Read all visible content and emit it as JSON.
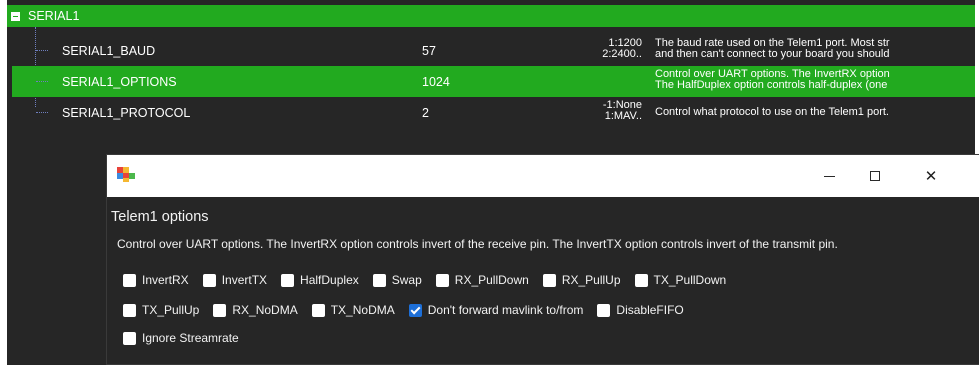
{
  "tree": {
    "group": {
      "label": "SERIAL1"
    },
    "params": [
      {
        "name": "SERIAL1_BAUD",
        "value": "57",
        "options": [
          "1:1200",
          "2:2400.."
        ],
        "desc": [
          "The baud rate used on the Telem1 port. Most str",
          "and then can't connect to your board you should"
        ],
        "selected": false
      },
      {
        "name": "SERIAL1_OPTIONS",
        "value": "1024",
        "options": [],
        "desc": [
          "Control over UART options. The InvertRX option",
          "The HalfDuplex option controls half-duplex (one"
        ],
        "selected": true
      },
      {
        "name": "SERIAL1_PROTOCOL",
        "value": "2",
        "options": [
          "-1:None",
          "1:MAV.."
        ],
        "desc": [
          "Control what protocol to use on the Telem1 port."
        ],
        "selected": false
      }
    ]
  },
  "dialog": {
    "title": "Telem1 options",
    "description": "Control over UART options. The InvertRX option controls invert of the receive pin. The InvertTX option controls invert of the transmit pin.",
    "window_controls": {
      "minimize": "—",
      "close": "✕"
    },
    "option_rows": [
      [
        {
          "label": "InvertRX",
          "checked": false
        },
        {
          "label": "InvertTX",
          "checked": false
        },
        {
          "label": "HalfDuplex",
          "checked": false
        },
        {
          "label": "Swap",
          "checked": false
        },
        {
          "label": "RX_PullDown",
          "checked": false
        },
        {
          "label": "RX_PullUp",
          "checked": false
        },
        {
          "label": "TX_PullDown",
          "checked": false
        }
      ],
      [
        {
          "label": "TX_PullUp",
          "checked": false
        },
        {
          "label": "RX_NoDMA",
          "checked": false
        },
        {
          "label": "TX_NoDMA",
          "checked": false
        },
        {
          "label": "Don't forward mavlink to/from",
          "checked": true
        },
        {
          "label": "DisableFIFO",
          "checked": false
        }
      ],
      [
        {
          "label": "Ignore Streamrate",
          "checked": false
        }
      ]
    ]
  },
  "colors": {
    "selected_row": "#22aa1f",
    "background": "#262626",
    "checkbox_checked": "#1d6fd8",
    "tree_line": "#6f7fbf"
  }
}
